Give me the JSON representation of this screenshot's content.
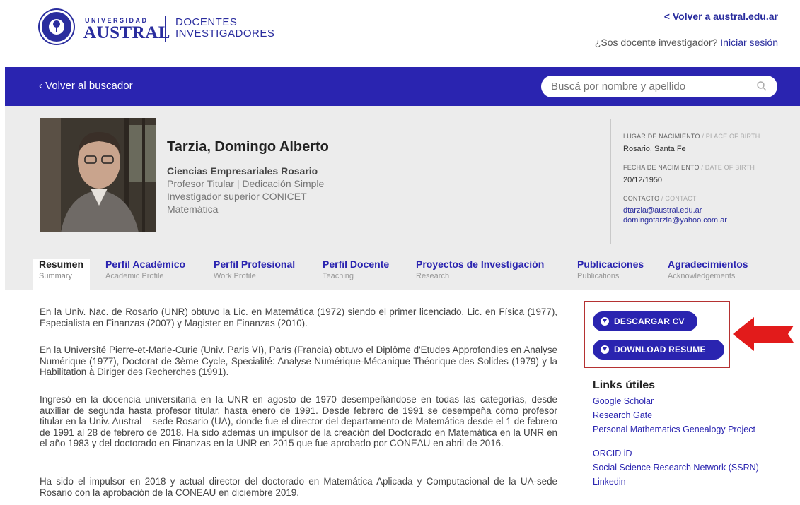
{
  "header": {
    "logo_univ": "UNIVERSIDAD",
    "logo_name": "AUSTRAL",
    "logo_sub_1": "DOCENTES",
    "logo_sub_2": "INVESTIGADORES",
    "back_link": "< Volver a austral.edu.ar",
    "login_question": "¿Sos docente investigador?",
    "login_link": "Iniciar sesión"
  },
  "band": {
    "back": "‹ Volver al buscador",
    "search_placeholder": "Buscá por nombre y apellido"
  },
  "profile": {
    "name": "Tarzia, Domingo Alberto",
    "department": "Ciencias Empresariales Rosario",
    "roles": [
      "Profesor Titular | Dedicación Simple",
      "Investigador superior CONICET",
      "Matemática"
    ],
    "birth_place_label": "LUGAR DE NACIMIENTO",
    "birth_place_label_en": "/ PLACE OF BIRTH",
    "birth_place": "Rosario, Santa Fe",
    "birth_date_label": "FECHA DE NACIMIENTO",
    "birth_date_label_en": "/ DATE OF BIRTH",
    "birth_date": "20/12/1950",
    "contact_label": "CONTACTO",
    "contact_label_en": "/ CONTACT",
    "emails": [
      "dtarzia@austral.edu.ar",
      "domingotarzia@yahoo.com.ar"
    ]
  },
  "tabs": [
    {
      "label": "Resumen",
      "sub": "Summary"
    },
    {
      "label": "Perfil Académico",
      "sub": "Academic Profile"
    },
    {
      "label": "Perfil Profesional",
      "sub": "Work Profile"
    },
    {
      "label": "Perfil Docente",
      "sub": "Teaching"
    },
    {
      "label": "Proyectos de Investigación",
      "sub": "Research"
    },
    {
      "label": "Publicaciones",
      "sub": "Publications"
    },
    {
      "label": "Agradecimientos",
      "sub": "Acknowledgements"
    }
  ],
  "paragraphs": [
    "En la Univ. Nac. de Rosario (UNR) obtuvo la Lic. en Matemática (1972) siendo el primer licenciado, Lic. en Física (1977), Especialista en Finanzas (2007) y Magister en Finanzas (2010).",
    "En la Université Pierre-et-Marie-Curie (Univ. Paris VI), París (Francia) obtuvo el Diplôme d'Etudes Approfondies en Analyse Numérique (1977), Doctorat de 3ème Cycle, Specialité: Analyse Numérique-Mécanique Théorique des Solides (1979) y la Habilitation à Diriger des Recherches (1991).",
    "Ingresó en la docencia universitaria en la UNR en agosto de 1970 desempeñándose en todas las categorías, desde auxiliar de segunda hasta profesor titular, hasta enero de 1991. Desde febrero de 1991 se desempeña como profesor titular en la Univ. Austral – sede Rosario (UA), donde fue el director del departamento de Matemática desde el 1 de febrero de 1991 al 28 de febrero de 2018. Ha sido además un impulsor de la creación del Doctorado en Matemática en la UNR en el año 1983 y del doctorado en Finanzas en la UNR en 2015 que fue aprobado por CONEAU en abril de 2016.",
    "Ha sido el impulsor en 2018 y actual director del doctorado en Matemática Aplicada y Computacional de la UA-sede Rosario con la aprobación de la CONEAU en diciembre 2019."
  ],
  "buttons": {
    "cv": "DESCARGAR CV",
    "resume": "DOWNLOAD RESUME"
  },
  "links": {
    "title": "Links útiles",
    "items": [
      "Google Scholar",
      "Research Gate",
      "Personal Mathematics Genealogy Project",
      "ORCID iD",
      "Social Science Research Network (SSRN)",
      "Linkedin"
    ]
  },
  "colors": {
    "brand": "#2a24b0",
    "highlight": "#b53232",
    "arrow": "#e21b1b"
  }
}
